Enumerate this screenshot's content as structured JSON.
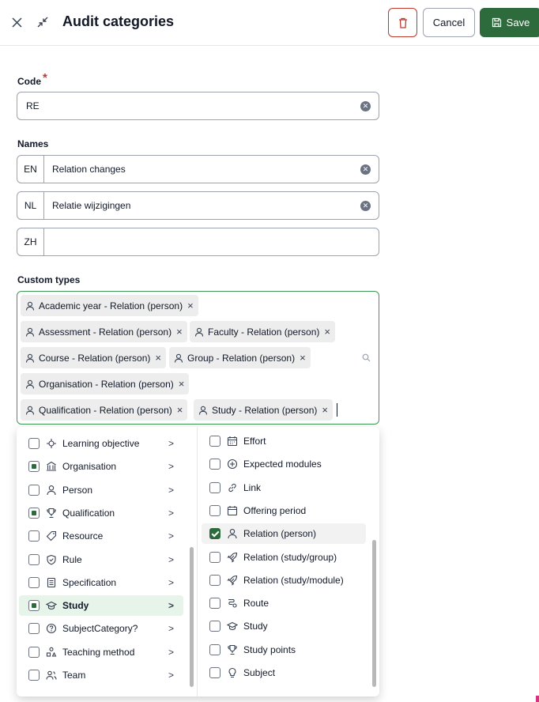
{
  "header": {
    "title": "Audit categories",
    "cancel_label": "Cancel",
    "save_label": "Save"
  },
  "code": {
    "label": "Code",
    "required_mark": "*",
    "value": "RE"
  },
  "names": {
    "label": "Names",
    "rows": [
      {
        "lang": "EN",
        "value": "Relation changes"
      },
      {
        "lang": "NL",
        "value": "Relatie wijzigingen"
      },
      {
        "lang": "ZH",
        "value": ""
      }
    ]
  },
  "custom_types": {
    "label": "Custom types",
    "chips": [
      "Academic year - Relation (person)",
      "Assessment - Relation (person)",
      "Faculty - Relation (person)",
      "Course - Relation (person)",
      "Group - Relation (person)",
      "Organisation - Relation (person)",
      "Qualification - Relation (person)",
      "Study - Relation (person)"
    ],
    "remove_glyph": "×"
  },
  "dropdown": {
    "left_items": [
      {
        "label": "Learning objective",
        "state": "unchecked",
        "icon": "target-icon"
      },
      {
        "label": "Organisation",
        "state": "partial",
        "icon": "building-icon"
      },
      {
        "label": "Person",
        "state": "unchecked",
        "icon": "person-icon"
      },
      {
        "label": "Qualification",
        "state": "partial",
        "icon": "trophy-icon"
      },
      {
        "label": "Resource",
        "state": "unchecked",
        "icon": "tag-icon"
      },
      {
        "label": "Rule",
        "state": "unchecked",
        "icon": "shield-check-icon"
      },
      {
        "label": "Specification",
        "state": "unchecked",
        "icon": "document-icon"
      },
      {
        "label": "Study",
        "state": "partial",
        "icon": "graduation-cap-icon",
        "selected": true
      },
      {
        "label": "SubjectCategory?",
        "state": "unchecked",
        "icon": "question-circle-icon"
      },
      {
        "label": "Teaching method",
        "state": "unchecked",
        "icon": "shapes-icon"
      },
      {
        "label": "Team",
        "state": "unchecked",
        "icon": "team-icon"
      }
    ],
    "right_items": [
      {
        "label": "Effort",
        "state": "unchecked",
        "icon": "calendar-grid-icon"
      },
      {
        "label": "Expected modules",
        "state": "unchecked",
        "icon": "plus-circle-icon"
      },
      {
        "label": "Link",
        "state": "unchecked",
        "icon": "link-icon"
      },
      {
        "label": "Offering period",
        "state": "unchecked",
        "icon": "calendar-icon"
      },
      {
        "label": "Relation (person)",
        "state": "checked",
        "icon": "person-icon",
        "highlighted": true
      },
      {
        "label": "Relation (study/group)",
        "state": "unchecked",
        "icon": "rocket-icon"
      },
      {
        "label": "Relation (study/module)",
        "state": "unchecked",
        "icon": "rocket-icon"
      },
      {
        "label": "Route",
        "state": "unchecked",
        "icon": "route-icon"
      },
      {
        "label": "Study",
        "state": "unchecked",
        "icon": "graduation-cap-icon"
      },
      {
        "label": "Study points",
        "state": "unchecked",
        "icon": "trophy-icon"
      },
      {
        "label": "Subject",
        "state": "unchecked",
        "icon": "lightbulb-icon"
      }
    ],
    "chevron_glyph": ">"
  },
  "colors": {
    "primary": "#2e6b3c",
    "danger": "#c0392b",
    "focus_border": "#3f9957",
    "selected_row": "#e6f4ea"
  }
}
